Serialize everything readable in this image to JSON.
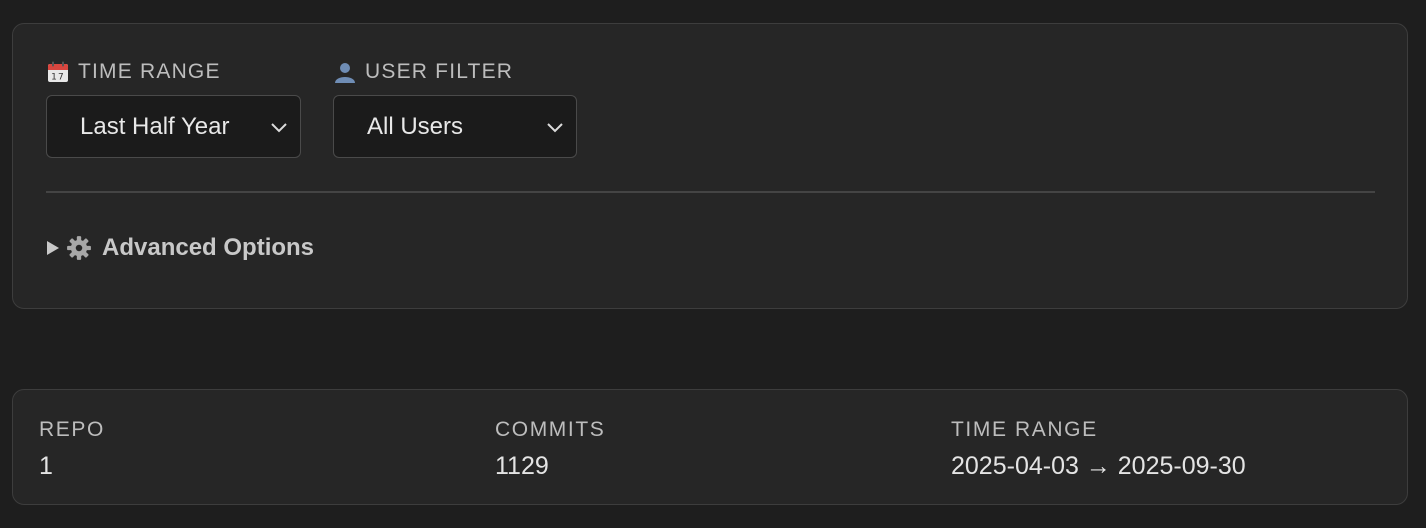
{
  "filters": {
    "time_range": {
      "icon": "calendar-icon",
      "label": "TIME RANGE",
      "selected": "Last Half Year"
    },
    "user_filter": {
      "icon": "user-icon",
      "label": "USER FILTER",
      "selected": "All Users"
    },
    "advanced": {
      "icon": "gear-icon",
      "label": "Advanced Options"
    }
  },
  "stats": {
    "repo": {
      "label": "REPO",
      "value": "1"
    },
    "commits": {
      "label": "COMMITS",
      "value": "1129"
    },
    "time_range": {
      "label": "TIME RANGE",
      "value": "2025-04-03 → 2025-09-30"
    }
  },
  "colors": {
    "background": "#1e1e1e",
    "panel": "#262626",
    "border": "#3d3d3d"
  }
}
